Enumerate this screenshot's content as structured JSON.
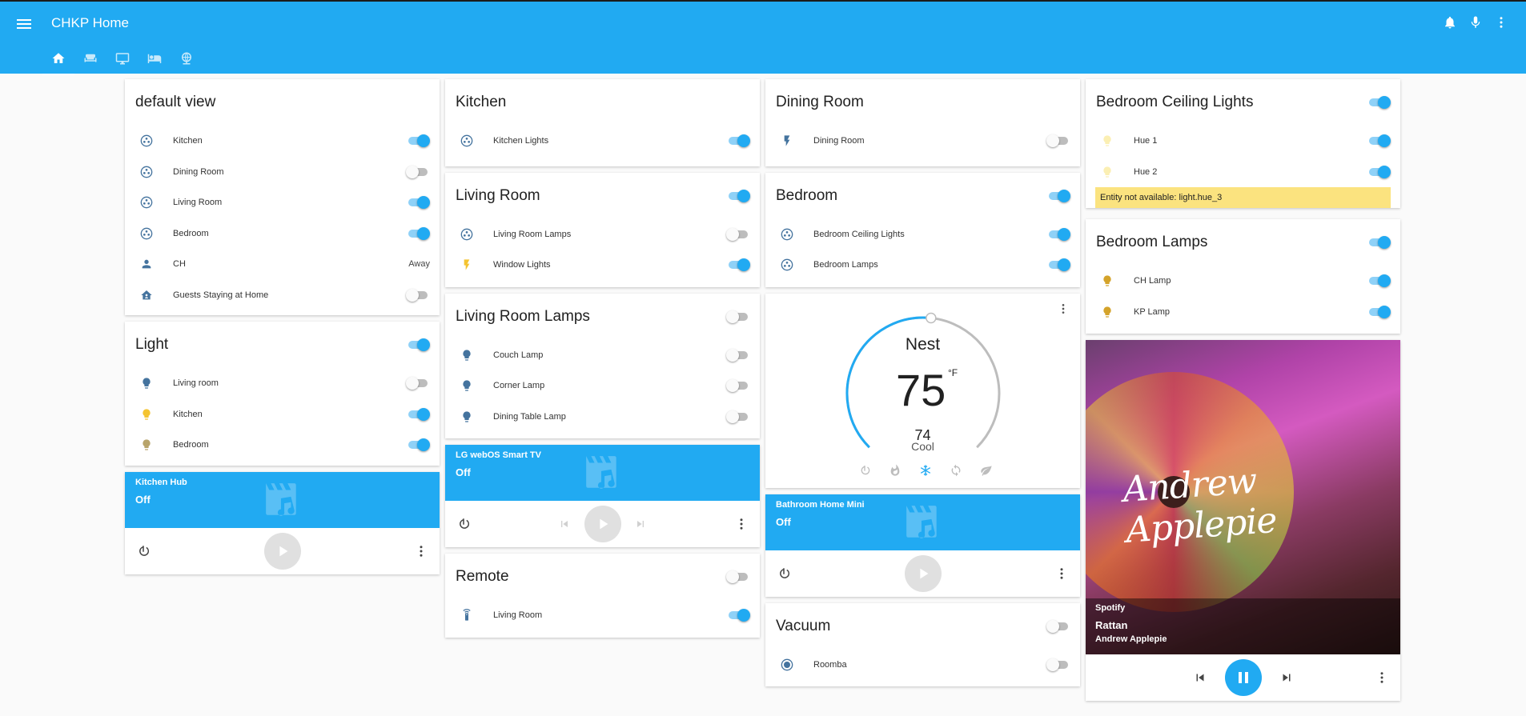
{
  "app": {
    "title": "CHKP Home"
  },
  "colors": {
    "accent": "#21aaf2",
    "toggle_on": "#21aaf2",
    "warning": "#fbe37f",
    "bulb_on": "#f4c430",
    "bulb_off": "#44739e"
  },
  "columns": {
    "col1": {
      "default_view": {
        "title": "default view",
        "rows": [
          {
            "label": "Kitchen",
            "icon": "group-icon",
            "on": true
          },
          {
            "label": "Dining Room",
            "icon": "group-icon",
            "on": false
          },
          {
            "label": "Living Room",
            "icon": "group-icon",
            "on": true
          },
          {
            "label": "Bedroom",
            "icon": "group-icon",
            "on": true
          },
          {
            "label": "CH",
            "icon": "person-icon",
            "state": "Away"
          },
          {
            "label": "Guests Staying at Home",
            "icon": "home-icon",
            "on": false
          }
        ]
      },
      "light": {
        "title": "Light",
        "header_on": true,
        "rows": [
          {
            "label": "Living room",
            "icon": "bulb-icon",
            "on": false
          },
          {
            "label": "Kitchen",
            "icon": "bulb-icon",
            "on": true
          },
          {
            "label": "Bedroom",
            "icon": "bulb-icon",
            "on": true
          }
        ]
      },
      "kitchen_hub": {
        "name": "Kitchen Hub",
        "state": "Off"
      }
    },
    "col2": {
      "kitchen": {
        "title": "Kitchen",
        "rows": [
          {
            "label": "Kitchen Lights",
            "icon": "group-icon",
            "on": true
          }
        ]
      },
      "living_room": {
        "title": "Living Room",
        "header_on": true,
        "rows": [
          {
            "label": "Living Room Lamps",
            "icon": "group-icon",
            "on": false
          },
          {
            "label": "Window Lights",
            "icon": "flash-icon",
            "on": true
          }
        ]
      },
      "living_room_lamps": {
        "title": "Living Room Lamps",
        "header_on": false,
        "rows": [
          {
            "label": "Couch Lamp",
            "icon": "bulb-icon",
            "on": false
          },
          {
            "label": "Corner Lamp",
            "icon": "bulb-icon",
            "on": false
          },
          {
            "label": "Dining Table Lamp",
            "icon": "bulb-icon",
            "on": false
          }
        ]
      },
      "lg_tv": {
        "name": "LG webOS Smart TV",
        "state": "Off"
      },
      "remote": {
        "title": "Remote",
        "header_on": false,
        "rows": [
          {
            "label": "Living Room",
            "icon": "remote-icon",
            "on": true
          }
        ]
      }
    },
    "col3": {
      "dining_room": {
        "title": "Dining Room",
        "rows": [
          {
            "label": "Dining Room",
            "icon": "flash-icon",
            "on": false
          }
        ]
      },
      "bedroom": {
        "title": "Bedroom",
        "header_on": true,
        "rows": [
          {
            "label": "Bedroom Ceiling Lights",
            "icon": "group-icon",
            "on": true
          },
          {
            "label": "Bedroom Lamps",
            "icon": "group-icon",
            "on": true
          }
        ]
      },
      "nest": {
        "name": "Nest",
        "current": "75",
        "unit": "°F",
        "target": "74",
        "mode": "Cool",
        "target_fraction": 0.9
      },
      "bathroom_mini": {
        "name": "Bathroom Home Mini",
        "state": "Off"
      },
      "vacuum": {
        "title": "Vacuum",
        "header_on": false,
        "rows": [
          {
            "label": "Roomba",
            "icon": "robot-vacuum-icon",
            "on": false
          }
        ]
      }
    },
    "col4": {
      "bedroom_ceiling": {
        "title": "Bedroom Ceiling Lights",
        "header_on": true,
        "rows": [
          {
            "label": "Hue 1",
            "icon": "bulb-icon",
            "on": true
          },
          {
            "label": "Hue 2",
            "icon": "bulb-icon",
            "on": true
          }
        ],
        "warning": "Entity not available: light.hue_3"
      },
      "bedroom_lamps": {
        "title": "Bedroom Lamps",
        "header_on": true,
        "rows": [
          {
            "label": "CH Lamp",
            "icon": "bulb-icon",
            "on": true
          },
          {
            "label": "KP Lamp",
            "icon": "bulb-icon",
            "on": true
          }
        ]
      },
      "spotify": {
        "app": "Spotify",
        "track": "Rattan",
        "artist": "Andrew Applepie",
        "art_text": "Andrew Applepie"
      }
    }
  }
}
